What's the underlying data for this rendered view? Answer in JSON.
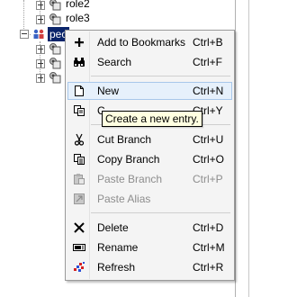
{
  "tree": {
    "nodes": [
      {
        "label": "role2",
        "state": "collapsed"
      },
      {
        "label": "role3",
        "state": "collapsed"
      },
      {
        "label": "peo",
        "state": "expanded",
        "selected": true
      },
      {
        "label": "",
        "state": "collapsed"
      },
      {
        "label": "",
        "state": "collapsed"
      },
      {
        "label": "",
        "state": "collapsed"
      }
    ]
  },
  "context_menu": {
    "items": [
      {
        "icon": "plus-icon",
        "label": "Add to Bookmarks",
        "shortcut": "Ctrl+B",
        "enabled": true
      },
      {
        "icon": "binoculars-icon",
        "label": "Search",
        "shortcut": "Ctrl+F",
        "enabled": true
      },
      {
        "icon": "new-document-icon",
        "label": "New",
        "shortcut": "Ctrl+N",
        "enabled": true,
        "highlighted": true
      },
      {
        "icon": "copy-dn-icon",
        "label": "Copy DN",
        "label_visible": "C",
        "shortcut": "Ctrl+Y",
        "enabled": true
      },
      {
        "icon": "scissors-icon",
        "label": "Cut Branch",
        "shortcut": "Ctrl+U",
        "enabled": true
      },
      {
        "icon": "copy-icon",
        "label": "Copy Branch",
        "shortcut": "Ctrl+O",
        "enabled": true
      },
      {
        "icon": "paste-icon",
        "label": "Paste Branch",
        "shortcut": "Ctrl+P",
        "enabled": false
      },
      {
        "icon": "paste-alias-icon",
        "label": "Paste Alias",
        "shortcut": "",
        "enabled": false
      },
      {
        "icon": "delete-x-icon",
        "label": "Delete",
        "shortcut": "Ctrl+D",
        "enabled": true
      },
      {
        "icon": "rename-icon",
        "label": "Rename",
        "shortcut": "Ctrl+M",
        "enabled": true
      },
      {
        "icon": "refresh-icon",
        "label": "Refresh",
        "shortcut": "Ctrl+R",
        "enabled": true
      }
    ]
  },
  "tooltip": {
    "text": "Create a new entry."
  },
  "colors": {
    "selection": "#0a246a",
    "menu_background": "#f4f4f4",
    "highlight_background": "#e6f0fb",
    "highlight_border": "#a8c7ea",
    "tooltip_background": "#ffffe1",
    "disabled_text": "#8d8d8d"
  }
}
